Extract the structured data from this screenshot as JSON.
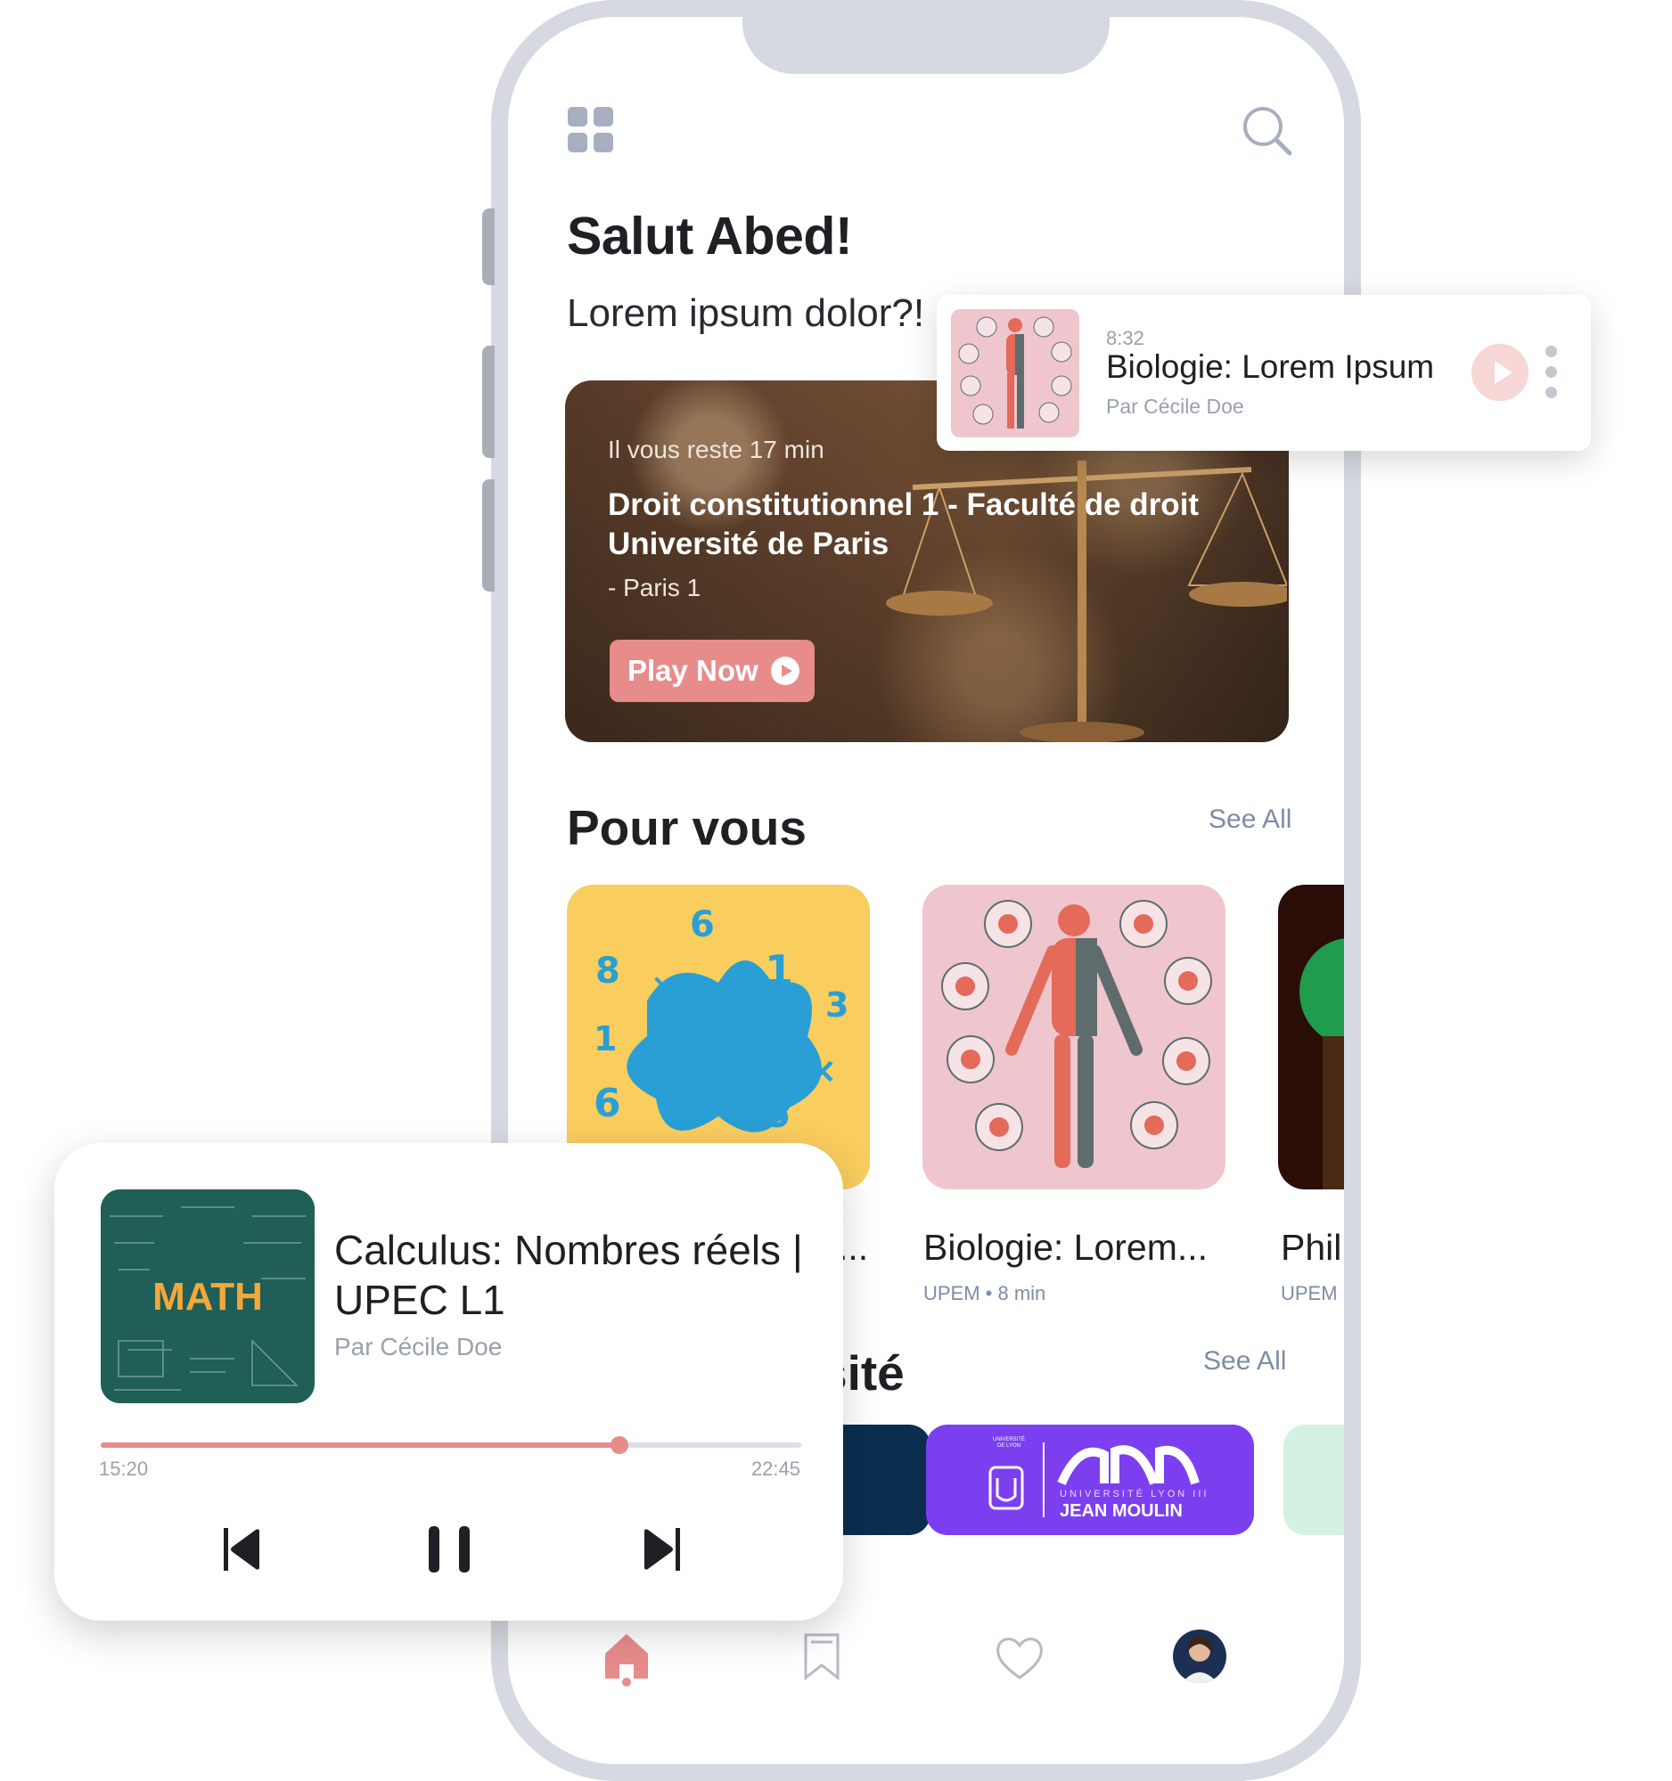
{
  "header": {
    "greeting": "Salut Abed!",
    "subtitle": "Lorem ipsum dolor?!"
  },
  "hero": {
    "remaining": "Il vous reste 17 min",
    "title": "Droit constitutionnel 1 - Faculté de droit Université de Paris",
    "place": "- Paris 1",
    "play_label": "Play Now"
  },
  "recommendations": {
    "title": "Pour vous",
    "see_all": "See All",
    "items": [
      {
        "title": "...",
        "meta": ""
      },
      {
        "title": "Biologie: Lorem...",
        "meta": "UPEM • 8 min"
      },
      {
        "title": "Phil",
        "meta": "UPEM"
      }
    ]
  },
  "universities": {
    "title": "sité",
    "see_all": "See All",
    "items": [
      {
        "name": "JEAN MOULIN",
        "tagline": "UNIVERSITÉ LYON III",
        "seal": "UNIVERSITÉ DE LYON"
      }
    ]
  },
  "notification": {
    "time": "8:32",
    "title": "Biologie: Lorem Ipsum",
    "author": "Par Cécile Doe"
  },
  "player": {
    "art_label": "MATH",
    "title": "Calculus: Nombres réels | UPEC L1",
    "author": "Par Cécile Doe",
    "elapsed": "15:20",
    "total": "22:45",
    "progress": 0.74
  },
  "colors": {
    "accent": "#e88b8b",
    "muted": "#7e8ca5",
    "frame": "#d6d9e1",
    "purple": "#7b3ff0",
    "navy": "#0b2e4f",
    "mint": "#d4f2e1"
  },
  "icons": [
    "grid-icon",
    "search-icon",
    "play-icon",
    "more-icon",
    "home-icon",
    "bookmark-icon",
    "heart-icon",
    "previous-icon",
    "pause-icon",
    "next-icon"
  ]
}
